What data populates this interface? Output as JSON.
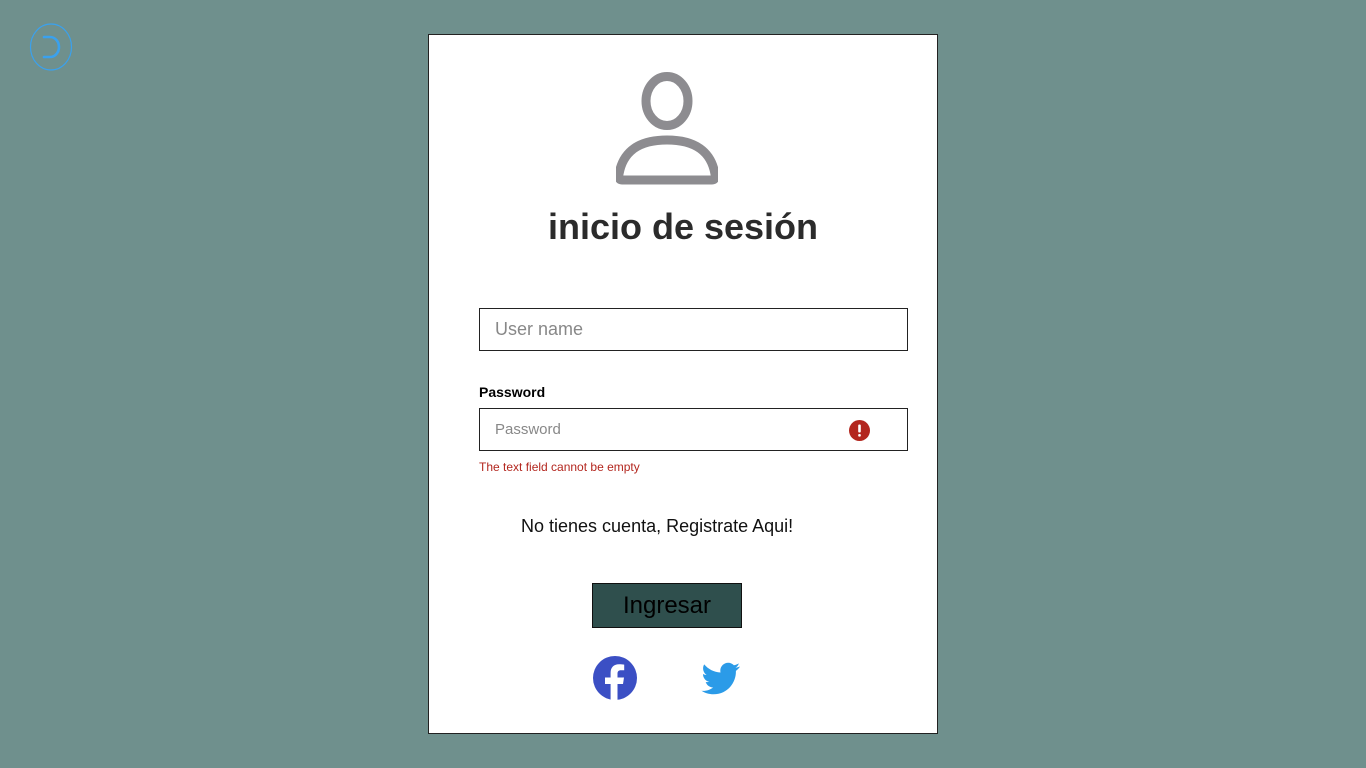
{
  "header": {
    "back_icon": "refresh-back-icon"
  },
  "login_card": {
    "avatar_icon": "user-avatar-icon",
    "title": "inicio de sesión",
    "username": {
      "value": "",
      "placeholder": "User name"
    },
    "password": {
      "label": "Password",
      "value": "",
      "placeholder": "Password",
      "error_icon": "error-alert-icon",
      "error_message": "The text field cannot be empty"
    },
    "register_link": "No tienes cuenta, Registrate Aqui!",
    "submit_label": "Ingresar",
    "social": {
      "facebook_icon": "facebook-icon",
      "twitter_icon": "twitter-icon"
    }
  },
  "colors": {
    "background": "#6f908d",
    "card": "#ffffff",
    "button": "#2f4f4d",
    "error": "#b3261e",
    "facebook": "#3b4fc4",
    "twitter": "#2b9be8",
    "back_icon": "#3aa1ee"
  }
}
